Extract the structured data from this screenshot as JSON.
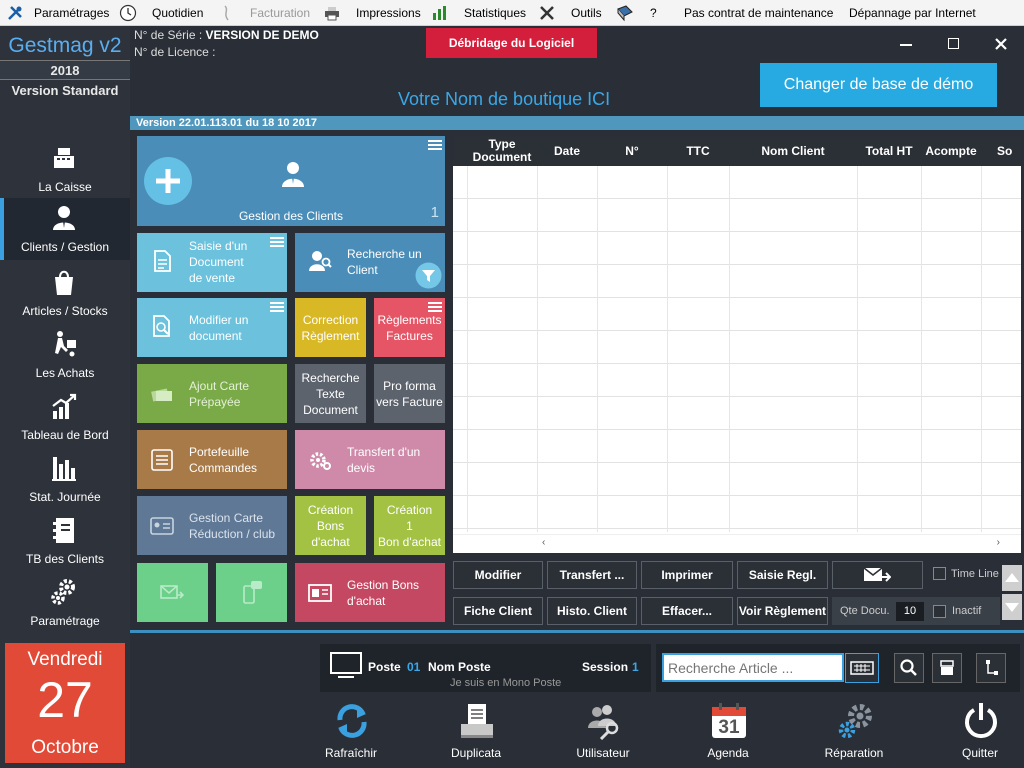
{
  "menubar": {
    "items": [
      "Paramétrages",
      "Quotidien",
      "Facturation",
      "Impressions",
      "Statistiques",
      "Outils",
      "?",
      "Pas contrat de maintenance",
      "Dépannage par Internet"
    ]
  },
  "sidebar": {
    "brand": "Gestmag v2",
    "year": "2018",
    "edition": "Version Standard",
    "items": [
      "La Caisse",
      "Clients / Gestion",
      "Articles / Stocks",
      "Les Achats",
      "Tableau de Bord",
      "Stat. Journée",
      "TB des Clients",
      "Paramétrage"
    ],
    "date": {
      "day": "Vendredi",
      "number": "27",
      "month": "Octobre"
    }
  },
  "header": {
    "serial_label": "N° de Série :",
    "serial_value": "VERSION DE DEMO",
    "licence_label": "N° de Licence :",
    "unlock_button": "Débridage du Logiciel",
    "change_db_button": "Changer de base de démo",
    "shop_name": "Votre Nom de boutique ICI",
    "version": "Version 22.01.113.01 du 18 10 2017"
  },
  "tiles": {
    "clients": "Gestion des Clients",
    "clients_count": "1",
    "saisie": [
      "Saisie d'un",
      "Document",
      "de vente"
    ],
    "recherche_client": [
      "Recherche un",
      "Client"
    ],
    "modifier": [
      "Modifier un",
      "document"
    ],
    "correction": [
      "Correction",
      "Règlement"
    ],
    "reglements": [
      "Règlements",
      "Factures"
    ],
    "ajout_carte": [
      "Ajout Carte",
      "Prépayée"
    ],
    "recherche_texte": [
      "Recherche",
      "Texte",
      "Document"
    ],
    "pro_forma": [
      "Pro forma",
      "vers Facture"
    ],
    "portefeuille": [
      "Portefeuille",
      "Commandes"
    ],
    "transfert": [
      "Transfert d'un",
      "devis"
    ],
    "gestion_carte": [
      "Gestion Carte",
      "Réduction / club"
    ],
    "creation_bons": [
      "Création",
      "Bons",
      "d'achat"
    ],
    "creation_1bon": [
      "Création",
      "1",
      "Bon d'achat"
    ],
    "gestion_bons": [
      "Gestion Bons",
      "d'achat"
    ]
  },
  "table": {
    "columns": [
      "Type Document",
      "Date",
      "N°",
      "TTC",
      "Nom Client",
      "Total HT",
      "Acompte",
      "So"
    ]
  },
  "actions": {
    "modifier": "Modifier",
    "transfert": "Transfert ...",
    "imprimer": "Imprimer",
    "saisie_regl": "Saisie Regl.",
    "fiche_client": "Fiche Client",
    "histo_client": "Histo. Client",
    "effacer": "Effacer...",
    "voir_reglement": "Voir Règlement",
    "time_line": "Time Line",
    "qte_docu_label": "Qte Docu.",
    "qte_docu_value": "10",
    "inactif": "Inactif"
  },
  "poste": {
    "poste_label": "Poste",
    "poste_value": "01",
    "nom_poste": "Nom Poste",
    "session_label": "Session",
    "session_value": "1",
    "mono": "Je suis en Mono Poste"
  },
  "search": {
    "placeholder": "Recherche Article ..."
  },
  "bottom": [
    "Rafraîchir",
    "Duplicata",
    "Utilisateur",
    "Agenda",
    "Réparation",
    "Quitter"
  ],
  "agenda_day": "31",
  "colors": {
    "accent": "#27aae1",
    "unlock": "#d41f3c",
    "date": "#e14a37"
  }
}
